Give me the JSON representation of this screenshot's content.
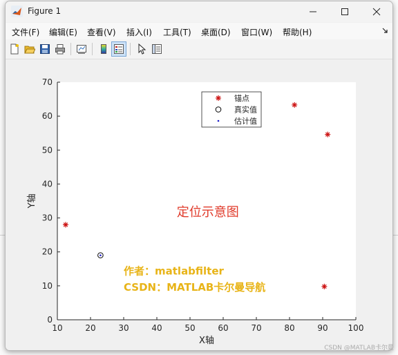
{
  "window": {
    "title": "Figure 1",
    "controls": [
      "minimize",
      "maximize",
      "close"
    ]
  },
  "menubar": {
    "items": [
      {
        "label": "文件(F)"
      },
      {
        "label": "编辑(E)"
      },
      {
        "label": "查看(V)"
      },
      {
        "label": "插入(I)"
      },
      {
        "label": "工具(T)"
      },
      {
        "label": "桌面(D)"
      },
      {
        "label": "窗口(W)"
      },
      {
        "label": "帮助(H)"
      }
    ]
  },
  "toolbar": {
    "icons": [
      "new-figure-icon",
      "open-file-icon",
      "save-icon",
      "print-icon",
      "link-plot-icon",
      "insert-colorbar-icon",
      "insert-legend-icon",
      "edit-plot-icon",
      "property-inspector-icon"
    ]
  },
  "chart_data": {
    "type": "scatter",
    "xlabel": "X轴",
    "ylabel": "Y轴",
    "xlim": [
      10,
      100
    ],
    "ylim": [
      0,
      70
    ],
    "xticks": [
      "10",
      "20",
      "30",
      "40",
      "50",
      "60",
      "70",
      "80",
      "90",
      "100"
    ],
    "yticks": [
      "0",
      "10",
      "20",
      "30",
      "40",
      "50",
      "60",
      "70"
    ],
    "grid": false,
    "legend_position": "top-right",
    "series": [
      {
        "name": "锚点",
        "marker": "asterisk",
        "color": "#cc1111",
        "points": [
          [
            12.5,
            28
          ],
          [
            81.5,
            63.3
          ],
          [
            91.5,
            54.6
          ],
          [
            90.5,
            9.8
          ]
        ]
      },
      {
        "name": "真实值",
        "marker": "circle",
        "color": "#000000",
        "points": [
          [
            23,
            19
          ]
        ]
      },
      {
        "name": "估计值",
        "marker": "dot",
        "color": "#1a1ac8",
        "points": [
          [
            23,
            19
          ]
        ]
      }
    ],
    "annotations": [
      {
        "text": "定位示意图",
        "x": 46,
        "y": 30.5,
        "color": "#e03a2a"
      },
      {
        "text": "作者：matlabfilter",
        "x": 30,
        "y": 13.3,
        "color": "#e8b418"
      },
      {
        "text": "CSDN：MATLAB卡尔曼导航",
        "x": 30,
        "y": 8.5,
        "color": "#e8b418"
      }
    ]
  },
  "watermark": "CSDN @MATLAB卡尔曼"
}
